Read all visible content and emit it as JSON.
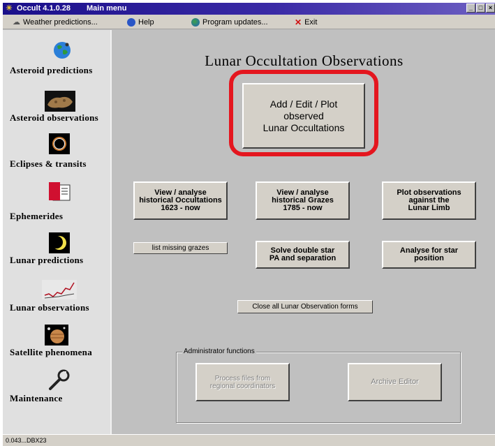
{
  "window": {
    "title": "Occult 4.1.0.28",
    "subtitle": "Main menu",
    "controls": [
      "minimize",
      "maximize",
      "close"
    ]
  },
  "menubar": {
    "items": [
      {
        "label": "Weather predictions...",
        "icon": "weather-icon"
      },
      {
        "label": "Help",
        "icon": "help-icon"
      },
      {
        "label": "Program updates...",
        "icon": "globe-icon"
      },
      {
        "label": "Exit",
        "icon": "exit-icon"
      }
    ]
  },
  "sidebar": {
    "items": [
      {
        "label": "Asteroid predictions",
        "icon": "earth-icon"
      },
      {
        "label": "Asteroid observations",
        "icon": "asteroid-icon"
      },
      {
        "label": "Eclipses & transits",
        "icon": "eclipse-icon"
      },
      {
        "label": "Ephemerides",
        "icon": "book-icon"
      },
      {
        "label": "Lunar predictions",
        "icon": "moon-icon"
      },
      {
        "label": "Lunar observations",
        "icon": "graph-icon"
      },
      {
        "label": "Satellite phenomena",
        "icon": "jupiter-icon"
      },
      {
        "label": "Maintenance",
        "icon": "wrench-icon"
      }
    ]
  },
  "main": {
    "title": "Lunar Occultation Observations",
    "primary_button": "Add / Edit / Plot\nobserved\nLunar Occultations",
    "buttons": {
      "view_historical_occultations": "View / analyse\nhistorical Occultations\n1623 - now",
      "view_historical_grazes": "View / analyse\nhistorical Grazes\n1785 - now",
      "plot_against_limb": "Plot observations\nagainst the\nLunar Limb",
      "list_missing_grazes": "list missing grazes",
      "solve_double_star": "Solve double star\nPA and separation",
      "analyse_star_position": "Analyse for star\nposition",
      "close_all_forms": "Close all Lunar Observation forms"
    },
    "admin_group": {
      "label": "Administrator functions",
      "process_files": "Process files from\nregional coordinators",
      "archive_editor": "Archive Editor"
    }
  },
  "status": {
    "text": "0.043...DBX23"
  },
  "colors": {
    "titlebar": "#1a0f8a",
    "highlight": "#e4161f",
    "face": "#c0c0c0"
  }
}
